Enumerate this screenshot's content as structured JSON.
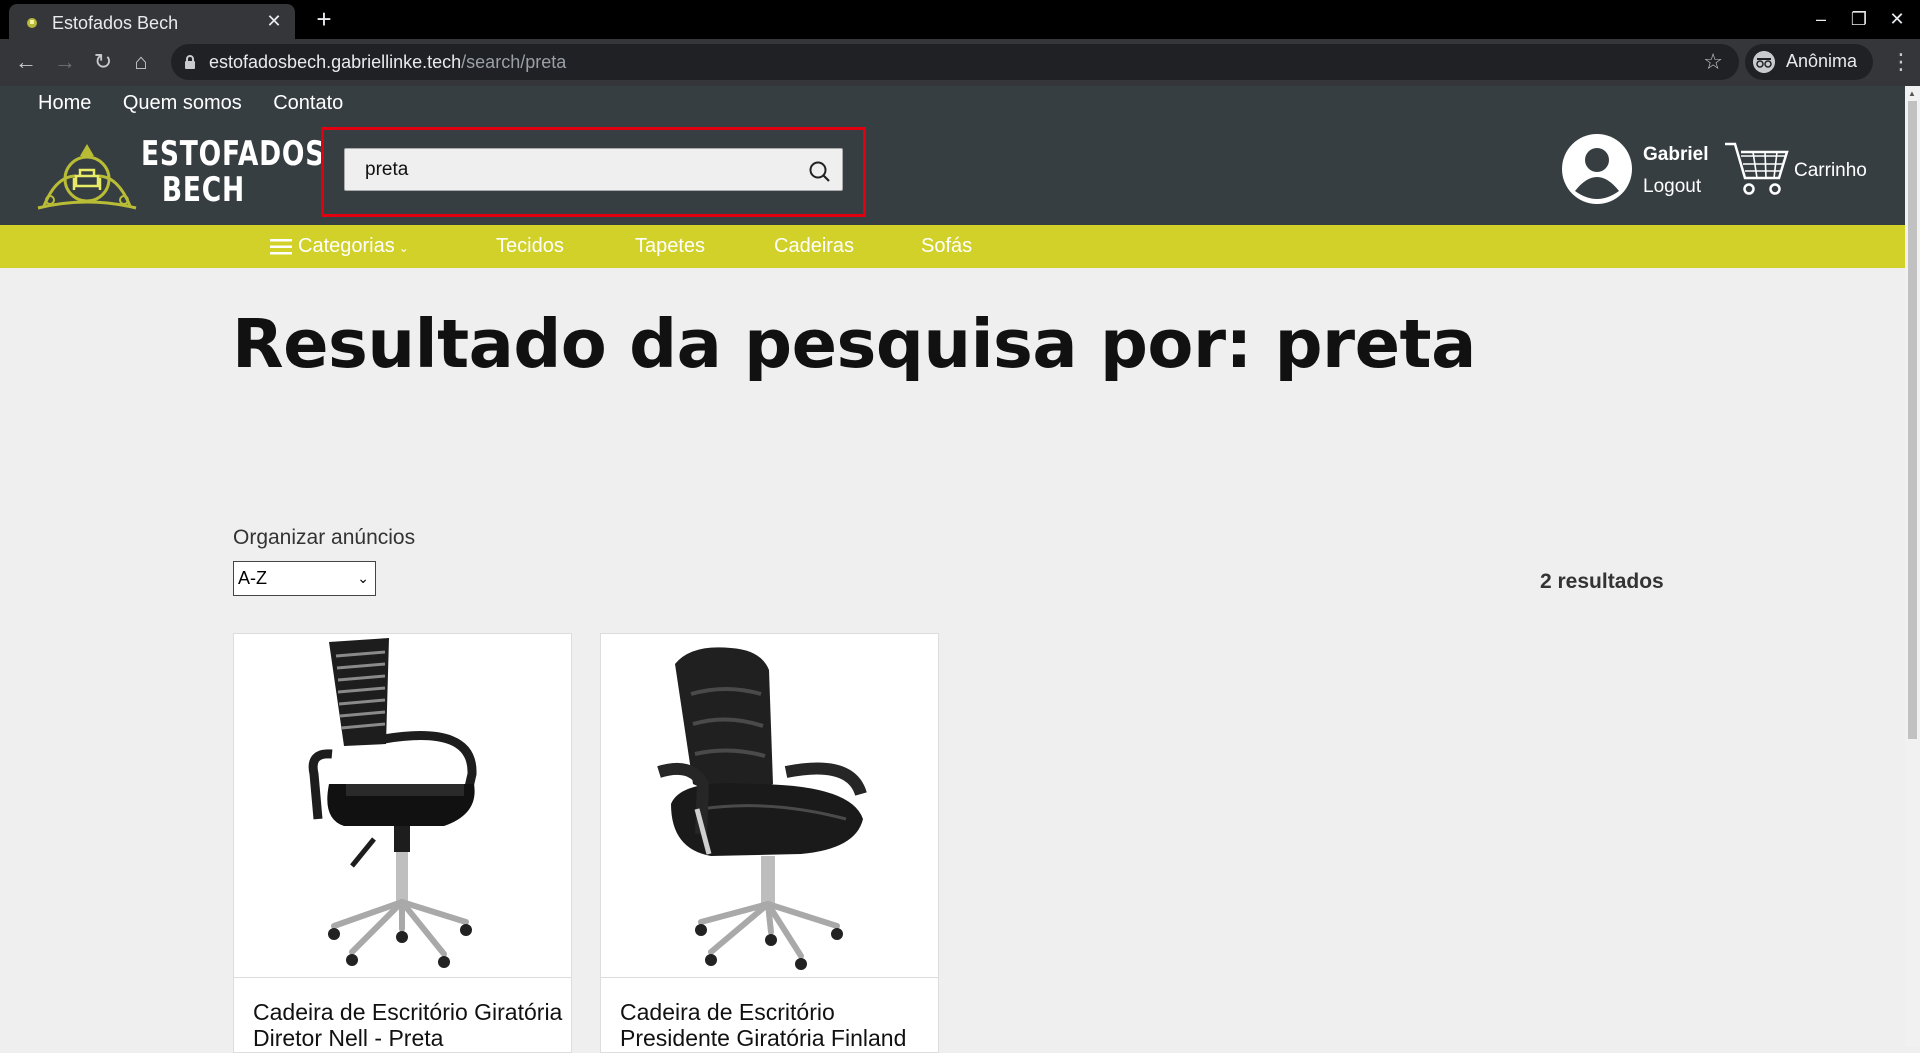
{
  "browser": {
    "tab_title": "Estofados Bech",
    "url_domain": "estofadosbech.gabriellinke.tech",
    "url_path": "/search/preta",
    "profile_label": "Anônima"
  },
  "header": {
    "top_links": [
      "Home",
      "Quem somos",
      "Contato"
    ],
    "logo_line1": "ESTOFADOS",
    "logo_line2": "BECH",
    "search_value": "preta",
    "user_name": "Gabriel",
    "logout_label": "Logout",
    "cart_label": "Carrinho"
  },
  "category_bar": {
    "categories_label": "Categorias",
    "items": [
      "Tecidos",
      "Tapetes",
      "Cadeiras",
      "Sofás"
    ]
  },
  "main": {
    "title": "Resultado da pesquisa por: preta",
    "sort_label": "Organizar anúncios",
    "sort_selected": "A-Z",
    "result_count": "2 resultados",
    "products": [
      {
        "title": "Cadeira de Escritório Giratória Diretor Nell - Preta"
      },
      {
        "title": "Cadeira de Escritório Presidente Giratória Finland"
      }
    ]
  },
  "colors": {
    "header_bg": "#363e42",
    "category_bar_bg": "#d1d12a",
    "search_highlight": "#e1000f"
  }
}
